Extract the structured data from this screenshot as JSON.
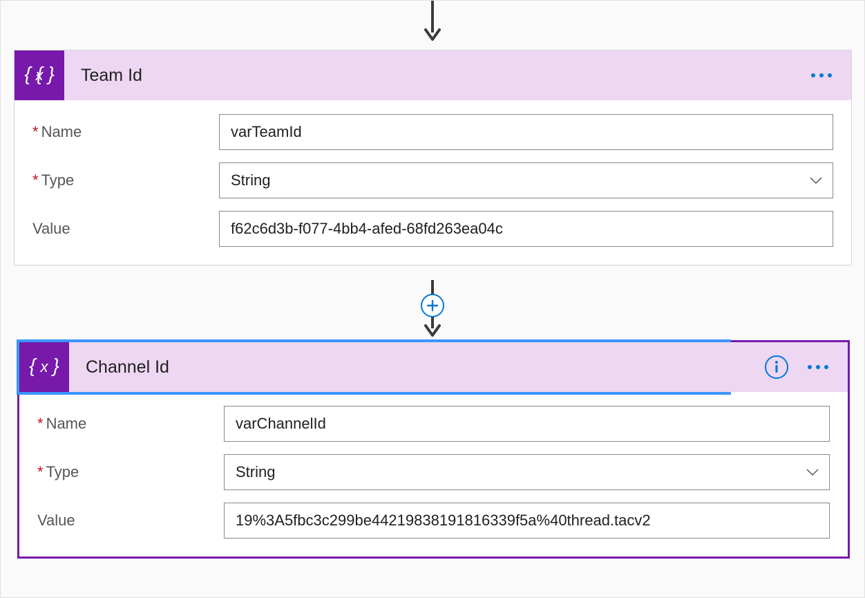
{
  "cards": [
    {
      "title": "Team Id",
      "selected": false,
      "show_info": false,
      "fields": {
        "name_label": "Name",
        "name_value": "varTeamId",
        "type_label": "Type",
        "type_value": "String",
        "value_label": "Value",
        "value_value": "f62c6d3b-f077-4bb4-afed-68fd263ea04c"
      }
    },
    {
      "title": "Channel Id",
      "selected": true,
      "show_info": true,
      "fields": {
        "name_label": "Name",
        "name_value": "varChannelId",
        "type_label": "Type",
        "type_value": "String",
        "value_label": "Value",
        "value_value": "19%3A5fbc3c299be44219838191816339f5a%40thread.tacv2"
      }
    }
  ],
  "icons": {
    "variable": "{x}",
    "info": "i",
    "plus": "+"
  },
  "colors": {
    "accent_purple": "#7719aa",
    "header_bg": "#edd7f2",
    "link_blue": "#0078d4",
    "selection_blue": "#3a95ff",
    "required_red": "#c50f1f"
  }
}
